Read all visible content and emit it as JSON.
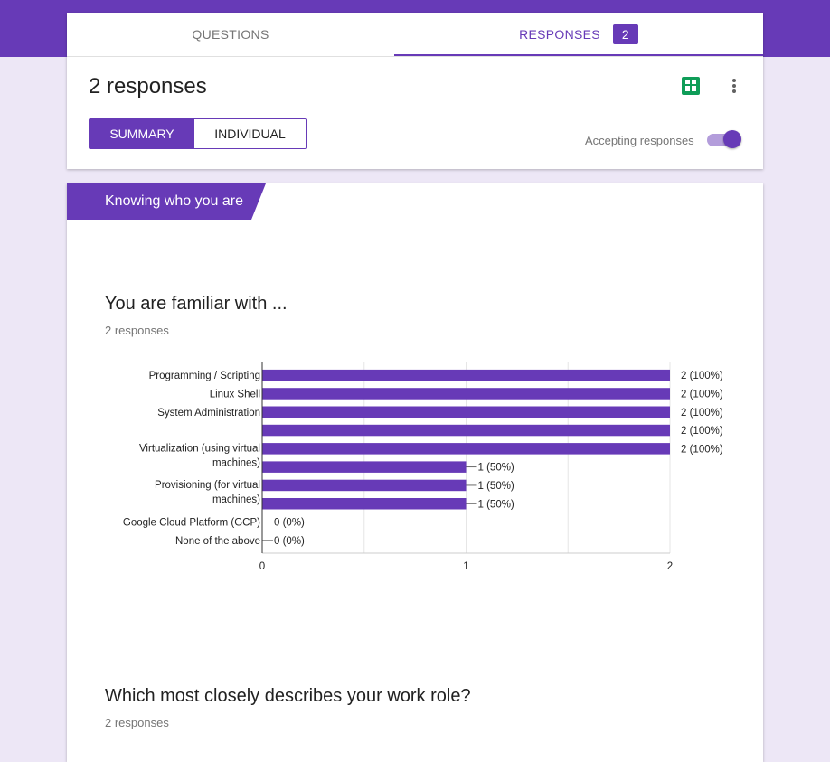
{
  "tabs": {
    "questions": "QUESTIONS",
    "responses": "RESPONSES",
    "responses_count": "2"
  },
  "header": {
    "title": "2 responses",
    "summary": "SUMMARY",
    "individual": "INDIVIDUAL",
    "accepting_label": "Accepting responses",
    "accepting_on": true
  },
  "section": {
    "label": "Knowing who you are"
  },
  "q1": {
    "title": "You are familiar with ...",
    "responses": "2 responses"
  },
  "q2": {
    "title": "Which most closely describes your work role?",
    "responses": "2 responses"
  },
  "colors": {
    "accent": "#673ab7",
    "background": "#ede7f6",
    "sheets": "#0f9d58"
  },
  "icons": {
    "sheets": "sheets-icon",
    "more": "more-vert-icon"
  },
  "chart_data": {
    "type": "bar",
    "orientation": "horizontal",
    "categories": [
      "Programming / Scripting",
      "Linux Shell",
      "System Administration",
      "",
      "Virtualization (using virtual machines)",
      "",
      "Provisioning (for virtual machines)",
      "",
      "Google Cloud Platform (GCP)",
      "None of the above"
    ],
    "category_lines": [
      [
        "Programming / Scripting"
      ],
      [
        "Linux Shell"
      ],
      [
        "System Administration"
      ],
      [],
      [
        "Virtualization (using virtual",
        "machines)"
      ],
      [],
      [
        "Provisioning (for virtual",
        "machines)"
      ],
      [],
      [
        "Google Cloud Platform (GCP)"
      ],
      [
        "None of the above"
      ]
    ],
    "values": [
      2,
      2,
      2,
      2,
      2,
      1,
      1,
      1,
      0,
      0
    ],
    "data_labels": [
      "2 (100%)",
      "2 (100%)",
      "2 (100%)",
      "2 (100%)",
      "2 (100%)",
      "1 (50%)",
      "1 (50%)",
      "1 (50%)",
      "0 (0%)",
      "0 (0%)"
    ],
    "xlim": [
      0,
      2
    ],
    "xticks": [
      "0",
      "1",
      "2"
    ],
    "grid": true,
    "color": "#673ab7"
  }
}
